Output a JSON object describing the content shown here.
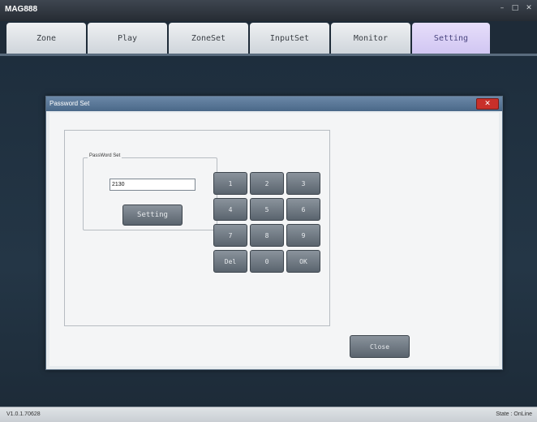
{
  "app": {
    "title": "MAG888"
  },
  "window_controls": {
    "minimize": "–",
    "maximize": "□",
    "close": "✕"
  },
  "tabs": [
    {
      "label": "Zone"
    },
    {
      "label": "Play"
    },
    {
      "label": "ZoneSet"
    },
    {
      "label": "InputSet"
    },
    {
      "label": "Monitor"
    },
    {
      "label": "Setting",
      "active": true
    }
  ],
  "dialog": {
    "title": "Password Set",
    "close_label": "✕",
    "group_label": "PassWord Set",
    "password_value": "2130",
    "setting_button": "Setting",
    "keypad": [
      "1",
      "2",
      "3",
      "4",
      "5",
      "6",
      "7",
      "8",
      "9",
      "Del",
      "0",
      "OK"
    ],
    "close_button": "Close"
  },
  "status": {
    "version": "V1.0.1.70628",
    "state": "State : OnLine"
  },
  "colors": {
    "active_tab": "#d6ccf4",
    "dialog_titlebar": "#5a7898",
    "close_red": "#c8302a"
  }
}
